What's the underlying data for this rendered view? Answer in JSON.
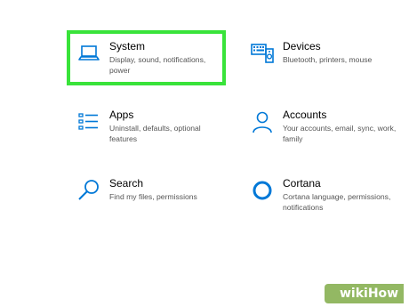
{
  "tiles": {
    "system": {
      "title": "System",
      "description": "Display, sound, notifications, power",
      "icon": "laptop-icon"
    },
    "devices": {
      "title": "Devices",
      "description": "Bluetooth, printers, mouse",
      "icon": "keyboard-speaker-icon"
    },
    "apps": {
      "title": "Apps",
      "description": "Uninstall, defaults, optional features",
      "icon": "apps-list-icon"
    },
    "accounts": {
      "title": "Accounts",
      "description": "Your accounts, email, sync, work, family",
      "icon": "person-icon"
    },
    "search": {
      "title": "Search",
      "description": "Find my files, permissions",
      "icon": "search-icon"
    },
    "cortana": {
      "title": "Cortana",
      "description": "Cortana language, permissions, notifications",
      "icon": "cortana-ring-icon"
    }
  },
  "watermark": {
    "text": "wikiHow"
  },
  "colors": {
    "icon": "#0078d7",
    "highlight": "#39e33a",
    "title": "#000000",
    "description": "#555555",
    "watermark": "#93b863"
  }
}
